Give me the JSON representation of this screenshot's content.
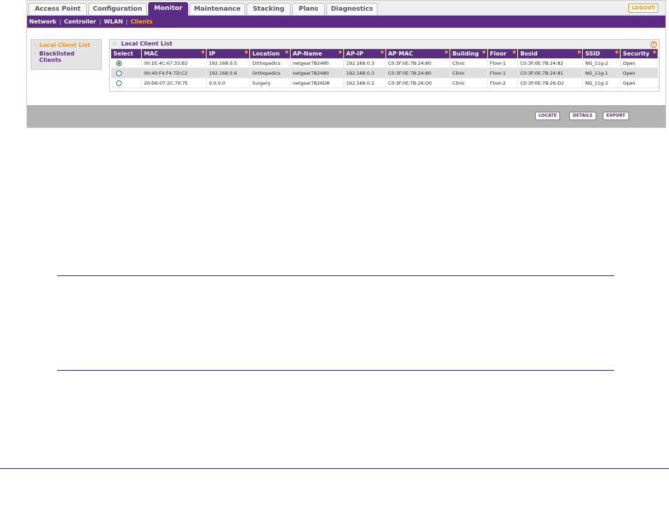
{
  "tabs": [
    {
      "label": "Access Point",
      "active": false
    },
    {
      "label": "Configuration",
      "active": false
    },
    {
      "label": "Monitor",
      "active": true
    },
    {
      "label": "Maintenance",
      "active": false
    },
    {
      "label": "Stacking",
      "active": false
    },
    {
      "label": "Plans",
      "active": false
    },
    {
      "label": "Diagnostics",
      "active": false
    }
  ],
  "logout_label": "LOGOUT",
  "subnav": [
    {
      "label": "Network",
      "active": false
    },
    {
      "label": "Controller",
      "active": false
    },
    {
      "label": "WLAN",
      "active": false
    },
    {
      "label": "Clients",
      "active": true
    }
  ],
  "sidebar": {
    "items": [
      {
        "label": "Local Client List",
        "active": true
      },
      {
        "label": "Blacklisted Clients",
        "active": false
      }
    ]
  },
  "panel": {
    "title": "Local Client List",
    "help_icon": "!"
  },
  "table": {
    "columns": [
      "Select",
      "MAC",
      "IP",
      "Location",
      "AP-Name",
      "AP-IP",
      "AP MAC",
      "Building",
      "Floor",
      "Bssid",
      "SSID",
      "Security"
    ],
    "rows": [
      {
        "selected": true,
        "mac": "00:1E:4C:67:33:B2",
        "ip": "192.168.0.5",
        "location": "Orthopedics",
        "ap_name": "netgear7B2480",
        "ap_ip": "192.168.0.3",
        "ap_mac": "C0:3F:0E:7B:24:80",
        "building": "Clinic",
        "floor": "Floor-1",
        "bssid": "C0:3F:0E:7B:24:82",
        "ssid": "NG_11g-2",
        "security": "Open"
      },
      {
        "selected": false,
        "mac": "00:40:F4:F4:7D:C2",
        "ip": "192.168.0.6",
        "location": "Orthopedics",
        "ap_name": "netgear7B2480",
        "ap_ip": "192.168.0.3",
        "ap_mac": "C0:3F:0E:7B:24:80",
        "building": "Clinic",
        "floor": "Floor-1",
        "bssid": "C0:3F:0E:7B:24:81",
        "ssid": "NG_11g-1",
        "security": "Open"
      },
      {
        "selected": false,
        "mac": "20:D6:07:2C:70:7E",
        "ip": "0.0.0.0",
        "location": "Surgery",
        "ap_name": "netgear7B26D8",
        "ap_ip": "192.168.0.2",
        "ap_mac": "C0:3F:0E:7B:26:D0",
        "building": "Clinic",
        "floor": "Floor-2",
        "bssid": "C0:3F:0E:7B:26:D2",
        "ssid": "NG_11g-2",
        "security": "Open"
      }
    ]
  },
  "footer_buttons": [
    "LOCATE",
    "DETAILS",
    "EXPORT"
  ],
  "colors": {
    "brand_purple": "#5a2c84",
    "accent_orange": "#ff9900",
    "rule_blue": "#2a2a8c"
  }
}
